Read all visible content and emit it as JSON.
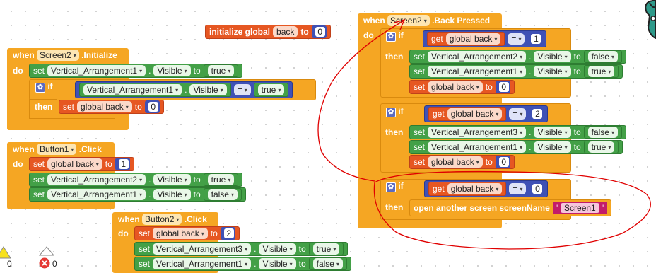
{
  "screen_events": {
    "initialize": {
      "when": "when",
      "component": "Screen2",
      "event": ".Initialize",
      "do": "do",
      "stmts": [
        {
          "set": "set",
          "comp": "Vertical_Arrangement1",
          "dot": ".",
          "prop": "Visible",
          "to": "to",
          "value": "true"
        }
      ],
      "if_label": "if",
      "cond": {
        "comp": "Vertical_Arrangement1",
        "dot": ".",
        "prop": "Visible",
        "op": "=",
        "value": "true"
      },
      "then_label": "then",
      "then_set": {
        "set": "set",
        "global": "global back",
        "to": "to",
        "value": "0"
      }
    },
    "back_pressed": {
      "when": "when",
      "component": "Screen2",
      "event": ".Back Pressed",
      "do": "do",
      "blocks": [
        {
          "if_label": "if",
          "get": "get",
          "global": "global back",
          "op": "=",
          "num": "1",
          "then_label": "then",
          "stmts": [
            {
              "set": "set",
              "comp": "Vertical_Arrangement2",
              "dot": ".",
              "prop": "Visible",
              "to": "to",
              "value": "false"
            },
            {
              "set": "set",
              "comp": "Vertical_Arrangement1",
              "dot": ".",
              "prop": "Visible",
              "to": "to",
              "value": "true"
            }
          ],
          "global_set": {
            "set": "set",
            "global": "global back",
            "to": "to",
            "value": "0"
          }
        },
        {
          "if_label": "if",
          "get": "get",
          "global": "global back",
          "op": "=",
          "num": "2",
          "then_label": "then",
          "stmts": [
            {
              "set": "set",
              "comp": "Vertical_Arrangement3",
              "dot": ".",
              "prop": "Visible",
              "to": "to",
              "value": "false"
            },
            {
              "set": "set",
              "comp": "Vertical_Arrangement1",
              "dot": ".",
              "prop": "Visible",
              "to": "to",
              "value": "true"
            }
          ],
          "global_set": {
            "set": "set",
            "global": "global back",
            "to": "to",
            "value": "0"
          }
        },
        {
          "if_label": "if",
          "get": "get",
          "global": "global back",
          "op": "=",
          "num": "0",
          "then_label": "then",
          "open_screen": {
            "label": "open another screen  screenName",
            "value": "Screen1"
          }
        }
      ]
    }
  },
  "global_init": {
    "label": "initialize global",
    "name": "back",
    "to": "to",
    "value": "0"
  },
  "button1_click": {
    "when": "when",
    "component": "Button1",
    "event": ".Click",
    "do": "do",
    "global_set": {
      "set": "set",
      "global": "global back",
      "to": "to",
      "value": "1"
    },
    "stmts": [
      {
        "set": "set",
        "comp": "Vertical_Arrangement2",
        "dot": ".",
        "prop": "Visible",
        "to": "to",
        "value": "true"
      },
      {
        "set": "set",
        "comp": "Vertical_Arrangement1",
        "dot": ".",
        "prop": "Visible",
        "to": "to",
        "value": "false"
      }
    ]
  },
  "button2_click": {
    "when": "when",
    "component": "Button2",
    "event": ".Click",
    "do": "do",
    "global_set": {
      "set": "set",
      "global": "global back",
      "to": "to",
      "value": "2"
    },
    "stmts": [
      {
        "set": "set",
        "comp": "Vertical_Arrangement3",
        "dot": ".",
        "prop": "Visible",
        "to": "to",
        "value": "true"
      },
      {
        "set": "set",
        "comp": "Vertical_Arrangement1",
        "dot": ".",
        "prop": "Visible",
        "to": "to",
        "value": "false"
      }
    ]
  },
  "status": {
    "warnings": "0",
    "errors": "0"
  },
  "colors": {
    "event": "#f5a623",
    "component_setter": "#43a047",
    "variable": "#e65722",
    "math": "#3f51b5",
    "text": "#c21b6a",
    "annotation": "#e00000"
  }
}
